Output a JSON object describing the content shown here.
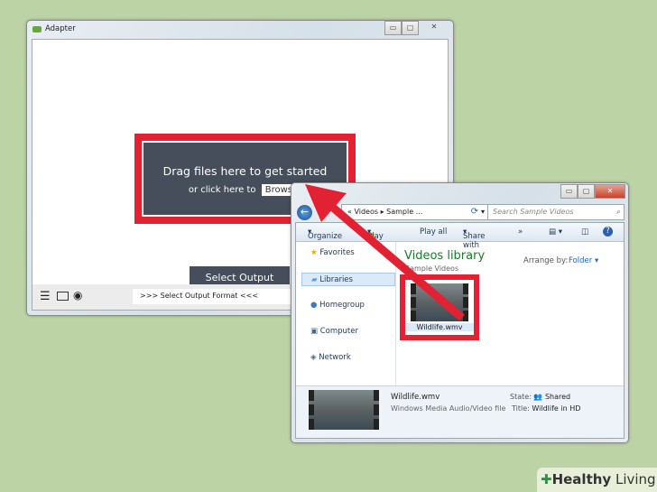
{
  "adapter": {
    "title": "Adapter",
    "drop_zone": {
      "heading": "Drag files here to get started",
      "subtext": "or click here to",
      "browse_label": "Browse"
    },
    "select_output_button": "Select Output Format",
    "status_field": ">>> Select Output Format <<<"
  },
  "explorer": {
    "breadcrumb": [
      "«",
      "Videos",
      "Sample ..."
    ],
    "search_placeholder": "Search Sample Videos",
    "toolbar": {
      "organize": "Organize",
      "play": "Play",
      "play_all": "Play all",
      "share_with": "Share with",
      "more": "»"
    },
    "nav": [
      "Favorites",
      "Libraries",
      "Homegroup",
      "Computer",
      "Network"
    ],
    "library_title": "Videos library",
    "library_subtitle": "Sample Videos",
    "arrange_by_label": "Arrange by:",
    "arrange_by_value": "Folder",
    "file": {
      "name": "Wildlife.wmv"
    },
    "details": {
      "name": "Wildlife.wmv",
      "type": "Windows Media Audio/Video file",
      "state_label": "State:",
      "state_value": "Shared",
      "title_label": "Title:",
      "title_value": "Wildlife in HD"
    }
  },
  "watermark": {
    "brand_bold": "Healthy",
    "brand_light": "Living"
  },
  "colors": {
    "highlight": "#e22232",
    "panel": "#454e5a",
    "background": "#bcd3a6"
  }
}
